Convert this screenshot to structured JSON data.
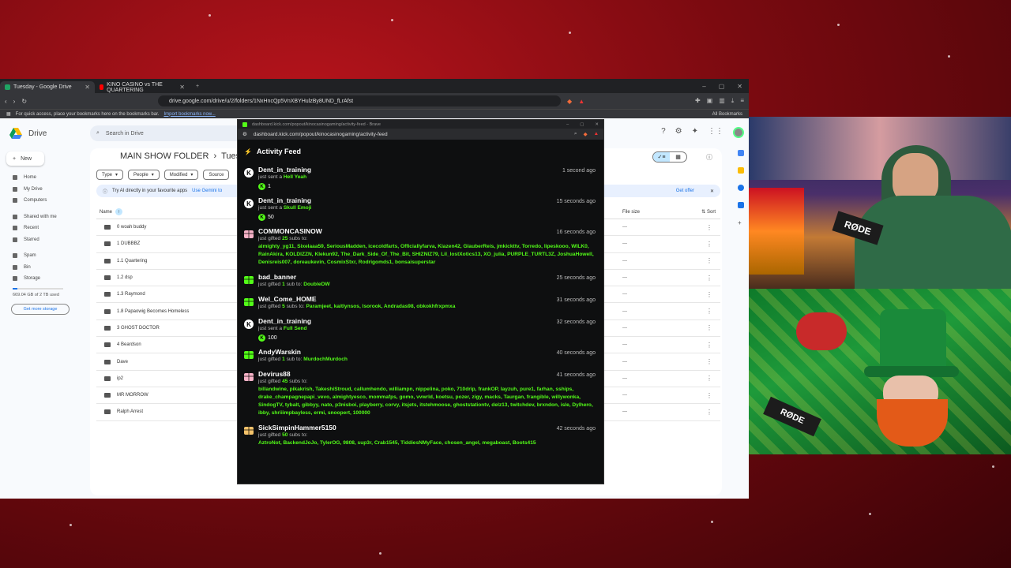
{
  "browser": {
    "tabs": [
      {
        "title": "Tuesday - Google Drive",
        "favicon_color": "#1fa463",
        "active": true
      },
      {
        "title": "KINO CASINO vs THE QUARTERING",
        "favicon_color": "#ff0000",
        "active": false
      }
    ],
    "url": "drive.google.com/drive/u/2/folders/1NxHncQp5VnXBYHulzBy8UND_fLrAfst",
    "bookmarks_prompt": "For quick access, place your bookmarks here on the bookmarks bar.",
    "import_link": "Import bookmarks now...",
    "all_bookmarks": "All Bookmarks"
  },
  "drive": {
    "app_name": "Drive",
    "search_placeholder": "Search in Drive",
    "new_label": "New",
    "nav": [
      "Home",
      "My Drive",
      "Computers"
    ],
    "nav2": [
      "Shared with me",
      "Recent",
      "Starred"
    ],
    "nav3": [
      "Spam",
      "Bin",
      "Storage"
    ],
    "storage_used": "669.04 GB of 2 TB used",
    "get_more_storage": "Get more storage",
    "breadcrumb_root": "MAIN SHOW FOLDER",
    "breadcrumb_current": "Tues",
    "filters": [
      "Type",
      "People",
      "Modified",
      "Source"
    ],
    "gemini_banner": "Try AI directly in your favourite apps",
    "gemini_link": "Use Gemini to",
    "get_offer": "Get offer",
    "columns": {
      "name": "Name",
      "size": "File size",
      "sort": "Sort"
    },
    "files": [
      "0 woah buddy",
      "1 DUBBBZ",
      "1.1 Quartering",
      "1.2 dsp",
      "1.3 Raymond",
      "1.8 Papaowig Becomes Homeless",
      "3 GHOST DOCTOR",
      "4 Beardson",
      "Dave",
      "ip2",
      "MR MORROW",
      "Ralph Arrest"
    ],
    "size_placeholder": "—"
  },
  "popup": {
    "window_title": "dashboard.kick.com/popout/kinocasinogaming/activity-feed - Brave",
    "url": "dashboard.kick.com/popout/kinocasinogaming/activity-feed",
    "heading": "Activity Feed",
    "items": [
      {
        "user": "Dent_in_training",
        "time": "1 second ago",
        "kind": "kick",
        "pre": "just sent a",
        "item": "Hell Yeah",
        "amount": "1"
      },
      {
        "user": "Dent_in_training",
        "time": "15 seconds ago",
        "kind": "kick",
        "pre": "just sent a",
        "item": "Skull Emoji",
        "amount": "50"
      },
      {
        "user": "COMMONCASINOW",
        "time": "16 seconds ago",
        "kind": "gift",
        "gift_color": "#f7b3c8",
        "pre": "just gifted",
        "count": "25",
        "post": "subs to:",
        "names": "almighty_yg11, Sixelaaa59, SeriousMadden, icecoldfarts, Officiallyfarva, Kiazen42, GlauberReis, jmkickttv, Torredo, lipeskooo, WILK0, RainAkira, KOLDIZZN, Klekun92, The_Dark_Side_Of_The_Bit, SHIZNIZ79, Lil_lostXotics13, XO_julia, PURPLE_TURTL3Z, JoshuaHowell, Denisreis007, doreaukevin, CosmixStxr, Rodrigomds1, bonsaisuperstar"
      },
      {
        "user": "bad_banner",
        "time": "25 seconds ago",
        "kind": "gift",
        "gift_color": "#53fc18",
        "pre": "just gifted",
        "count": "1",
        "post": "sub to:",
        "names": "DoubleDW"
      },
      {
        "user": "Wel_Come_HOME",
        "time": "31 seconds ago",
        "kind": "gift",
        "gift_color": "#53fc18",
        "pre": "just gifted",
        "count": "5",
        "post": "subs to:",
        "names": "Paramjeet, kaitlynsos, Isorook, Andradas98, obkokhfrxpmxa"
      },
      {
        "user": "Dent_in_training",
        "time": "32 seconds ago",
        "kind": "kick",
        "pre": "just sent a",
        "item": "Full Send",
        "amount": "100"
      },
      {
        "user": "AndyWarskin",
        "time": "40 seconds ago",
        "kind": "gift",
        "gift_color": "#53fc18",
        "pre": "just gifted",
        "count": "1",
        "post": "sub to:",
        "names": "MurdochMurdoch"
      },
      {
        "user": "Devirus88",
        "time": "41 seconds ago",
        "kind": "gift",
        "gift_color": "#f7b3c8",
        "pre": "just gifted",
        "count": "45",
        "post": "subs to:",
        "names": "billandwine, pikakrish, TakeshiStroud, callumhendo, williampn, nippelina, poko, 710drip, frankOP, layzuh, pure1, farhan, sships, drake_champagnepapi_vevo, almightyesco, mommafps, gomo, vvwrld, koetsu, pozer, zigy, macks, Taurgan, frangible, willywonka, SindogTV, tybalt, gibbyy, nato, p3nisboi, playberry, corvy, itsjets, itstehmoose, ghoststationtv, delz13, twitchdev, brxndon, isle, Dylhero, ibby, shriiimpbayless, ermi, snoopert, 100000"
      },
      {
        "user": "SickSimpinHammer5150",
        "time": "42 seconds ago",
        "kind": "gift",
        "gift_color": "#f4c36b",
        "pre": "just gifted",
        "count": "50",
        "post": "subs to:",
        "names": "AztroNot, BackendJoJo, TylerOG, 9808, sup3r, Crab1545, TiddiesNMyFace, chosen_angel, megaboast, Boots415"
      }
    ]
  },
  "webcams": {
    "cam1_label": "host webcam",
    "cam2_label": "co-host webcam",
    "mic_brand": "RØDE"
  }
}
